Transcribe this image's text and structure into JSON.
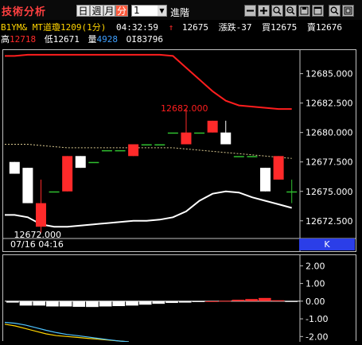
{
  "toolbar": {
    "title": "技術分析",
    "period_day": "日",
    "period_week": "週",
    "period_month": "月",
    "period_minute": "分",
    "interval_value": "1",
    "advanced": "進階",
    "icons": [
      "minus-icon",
      "plus-icon",
      "zoom-in-icon",
      "zoom-out-icon",
      "save-icon",
      "search-icon",
      "window-icon"
    ]
  },
  "info": {
    "row1": {
      "symbol": "B1YM& MT道瓊1209(1分)",
      "time": "04:32:59",
      "arrow": "↑",
      "last": "12675",
      "change": "漲跌-37",
      "bid": "買12675",
      "ask": "賣12676"
    },
    "row2": {
      "high_label": "高",
      "high": "12718",
      "low_label": "低",
      "low": "12671",
      "volume_label": "量",
      "volume": "4928",
      "oi_label": "OI",
      "oi": "83796"
    }
  },
  "chart_data": {
    "type": "candlestick",
    "main": {
      "y_ticks": [
        "12685.000",
        "12682.500",
        "12680.000",
        "12677.500",
        "12675.000",
        "12672.500"
      ],
      "ylim": [
        12671.0,
        12687.0
      ],
      "annotations": [
        {
          "text": "12682.000",
          "value": 12682.0
        },
        {
          "text": "12672.000",
          "value": 12672.0
        }
      ],
      "candles": [
        {
          "o": 12677.5,
          "c": 12676.5,
          "h": 12677.5,
          "l": 12676.5
        },
        {
          "o": 12677.0,
          "c": 12674.0,
          "h": 12677.0,
          "l": 12674.0
        },
        {
          "o": 12674.0,
          "c": 12672.0,
          "h": 12676.0,
          "l": 12671.5
        },
        {
          "o": 12675.0,
          "c": 12675.0,
          "h": 12675.0,
          "l": 12675.0
        },
        {
          "o": 12675.0,
          "c": 12678.0,
          "h": 12678.0,
          "l": 12675.0
        },
        {
          "o": 12678.0,
          "c": 12677.0,
          "h": 12678.0,
          "l": 12677.0
        },
        {
          "o": 12677.5,
          "c": 12677.5,
          "h": 12677.5,
          "l": 12677.5
        },
        {
          "o": 12678.5,
          "c": 12678.5,
          "h": 12678.5,
          "l": 12678.5
        },
        {
          "o": 12678.5,
          "c": 12678.5,
          "h": 12678.5,
          "l": 12678.5
        },
        {
          "o": 12679.0,
          "c": 12678.0,
          "h": 12679.0,
          "l": 12678.0
        },
        {
          "o": 12679.0,
          "c": 12679.0,
          "h": 12679.0,
          "l": 12679.0
        },
        {
          "o": 12679.0,
          "c": 12679.0,
          "h": 12679.0,
          "l": 12679.0
        },
        {
          "o": 12680.0,
          "c": 12680.0,
          "h": 12680.0,
          "l": 12680.0
        },
        {
          "o": 12680.0,
          "c": 12679.0,
          "h": 12682.0,
          "l": 12679.0
        },
        {
          "o": 12680.0,
          "c": 12680.0,
          "h": 12680.0,
          "l": 12680.0
        },
        {
          "o": 12681.0,
          "c": 12680.0,
          "h": 12681.0,
          "l": 12680.0
        },
        {
          "o": 12679.0,
          "c": 12680.0,
          "h": 12681.0,
          "l": 12679.0
        },
        {
          "o": 12678.0,
          "c": 12678.0,
          "h": 12678.0,
          "l": 12678.0
        },
        {
          "o": 12678.0,
          "c": 12678.0,
          "h": 12678.0,
          "l": 12678.0
        },
        {
          "o": 12675.0,
          "c": 12677.0,
          "h": 12677.0,
          "l": 12675.0
        },
        {
          "o": 12678.0,
          "c": 12676.0,
          "h": 12678.0,
          "l": 12676.0
        },
        {
          "o": 12675.0,
          "c": 12675.0,
          "h": 12676.0,
          "l": 12674.0
        }
      ],
      "upper_band": [
        12686.5,
        12686.6,
        12686.6,
        12686.6,
        12686.6,
        12686.6,
        12686.6,
        12686.6,
        12686.6,
        12686.6,
        12686.6,
        12686.6,
        12686.5,
        12685.5,
        12684.5,
        12683.5,
        12682.7,
        12682.3,
        12682.2,
        12682.1,
        12682.0,
        12682.0
      ],
      "lower_band": [
        12673.0,
        12672.8,
        12672.2,
        12672.0,
        12672.0,
        12672.1,
        12672.2,
        12672.3,
        12672.4,
        12672.5,
        12672.5,
        12672.6,
        12672.8,
        12673.3,
        12674.2,
        12674.8,
        12675.0,
        12674.9,
        12674.5,
        12674.2,
        12673.9,
        12673.6
      ],
      "mid_band": [
        12679.0,
        12679.0,
        12678.9,
        12678.8,
        12678.7,
        12678.7,
        12678.7,
        12678.7,
        12678.7,
        12678.7,
        12678.7,
        12678.7,
        12678.7,
        12678.6,
        12678.5,
        12678.4,
        12678.3,
        12678.2,
        12678.1,
        12678.0,
        12677.9,
        12677.8
      ],
      "time_label": "07/16 04:16",
      "k_label": "K"
    },
    "sub": {
      "y_ticks": [
        "2.00",
        "1.00",
        "0.00",
        "-1.00",
        "-2.00"
      ],
      "ylim": [
        -2.3,
        2.6
      ],
      "bars": [
        -0.08,
        -0.25,
        -0.25,
        -0.3,
        -0.3,
        -0.32,
        -0.33,
        -0.3,
        -0.28,
        -0.25,
        -0.2,
        -0.15,
        -0.1,
        -0.08,
        -0.05,
        0.0,
        0.02,
        0.08,
        0.12,
        0.18,
        0.05,
        -0.02
      ],
      "line1": [
        -1.3,
        -1.4,
        -1.55,
        -1.7,
        -1.85,
        -1.95,
        -2.0,
        -2.05,
        -2.1,
        -2.15,
        -2.2,
        -2.25,
        -2.3
      ],
      "line2": [
        -1.2,
        -1.25,
        -1.35,
        -1.5,
        -1.65,
        -1.78,
        -1.88,
        -1.95,
        -2.02,
        -2.1,
        -2.18,
        -2.25,
        -2.3
      ]
    }
  },
  "colors": {
    "up": "#ff2a2a",
    "down": "#ffffff",
    "flat": "#2fbf2f",
    "band": "#ff1e1e",
    "mid": "#d8c890",
    "axis": "#c0c0c0"
  }
}
